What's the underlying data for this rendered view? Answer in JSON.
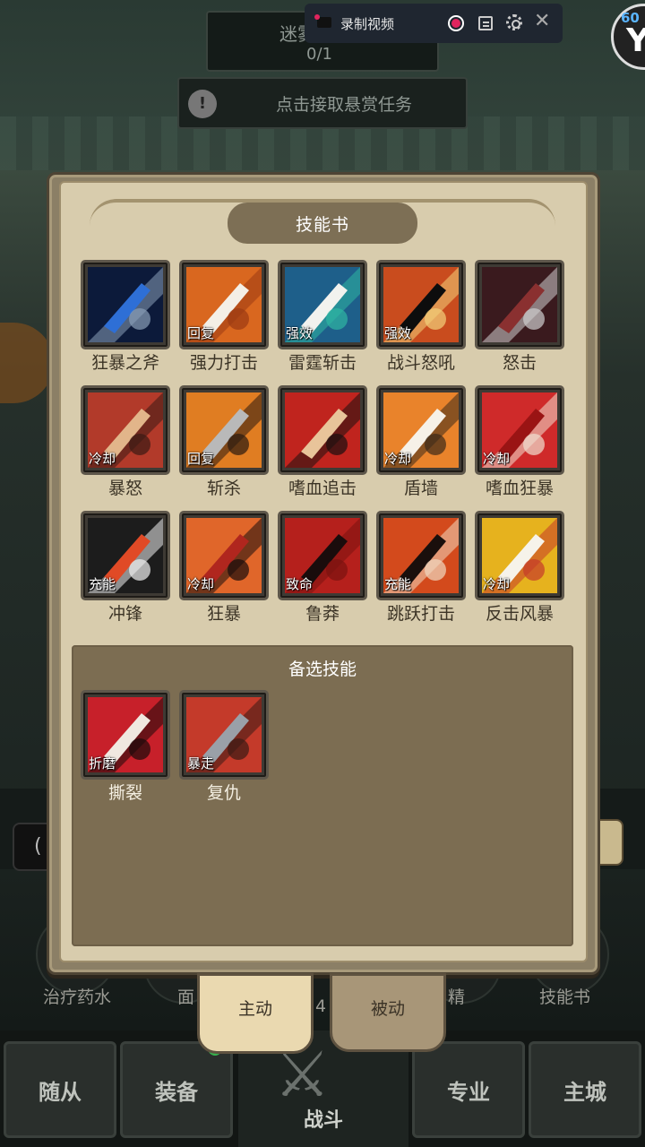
{
  "status": {
    "record_label": "录制视频",
    "fps": "60",
    "fps_letter": "Y"
  },
  "hud": {
    "quest_title": "迷雾",
    "quest_count": "0/1",
    "bounty_icon": "!",
    "bounty_text": "点击接取悬赏任务"
  },
  "panel": {
    "title": "技能书",
    "skills": [
      {
        "name": "狂暴之斧",
        "tag": "",
        "icon": "axe-icon"
      },
      {
        "name": "强力打击",
        "tag": "回复",
        "icon": "blade-strike-icon"
      },
      {
        "name": "雷霆斩击",
        "tag": "强效",
        "icon": "thunder-slash-icon"
      },
      {
        "name": "战斗怒吼",
        "tag": "强效",
        "icon": "battle-cry-icon"
      },
      {
        "name": "怒击",
        "tag": "",
        "icon": "rage-strike-icon"
      },
      {
        "name": "暴怒",
        "tag": "冷却",
        "icon": "fury-face-icon"
      },
      {
        "name": "斩杀",
        "tag": "回复",
        "icon": "execute-icon"
      },
      {
        "name": "嗜血追击",
        "tag": "",
        "icon": "fist-icon"
      },
      {
        "name": "盾墙",
        "tag": "冷却",
        "icon": "shield-wall-icon"
      },
      {
        "name": "嗜血狂暴",
        "tag": "冷却",
        "icon": "blood-mask-icon"
      },
      {
        "name": "冲锋",
        "tag": "充能",
        "icon": "charge-arrow-icon"
      },
      {
        "name": "狂暴",
        "tag": "冷却",
        "icon": "hooded-rage-icon"
      },
      {
        "name": "鲁莽",
        "tag": "致命",
        "icon": "reckless-fist-icon"
      },
      {
        "name": "跳跃打击",
        "tag": "充能",
        "icon": "leap-strike-icon"
      },
      {
        "name": "反击风暴",
        "tag": "冷却",
        "icon": "counter-storm-icon"
      }
    ],
    "alt_title": "备选技能",
    "alt_skills": [
      {
        "name": "撕裂",
        "tag": "折磨",
        "icon": "rend-icon"
      },
      {
        "name": "复仇",
        "tag": "暴走",
        "icon": "revenge-sword-icon"
      }
    ]
  },
  "tabs": {
    "active": "主动",
    "passive": "被动"
  },
  "background": {
    "potion_label": "治疗药水",
    "item2_label": "面",
    "item3_label": "精",
    "skillbook_label": "技能书",
    "count_text": "4",
    "pill_text": "("
  },
  "nav": {
    "followers": "随从",
    "equipment": "装备",
    "battle": "战斗",
    "profession": "专业",
    "main_city": "主城"
  }
}
